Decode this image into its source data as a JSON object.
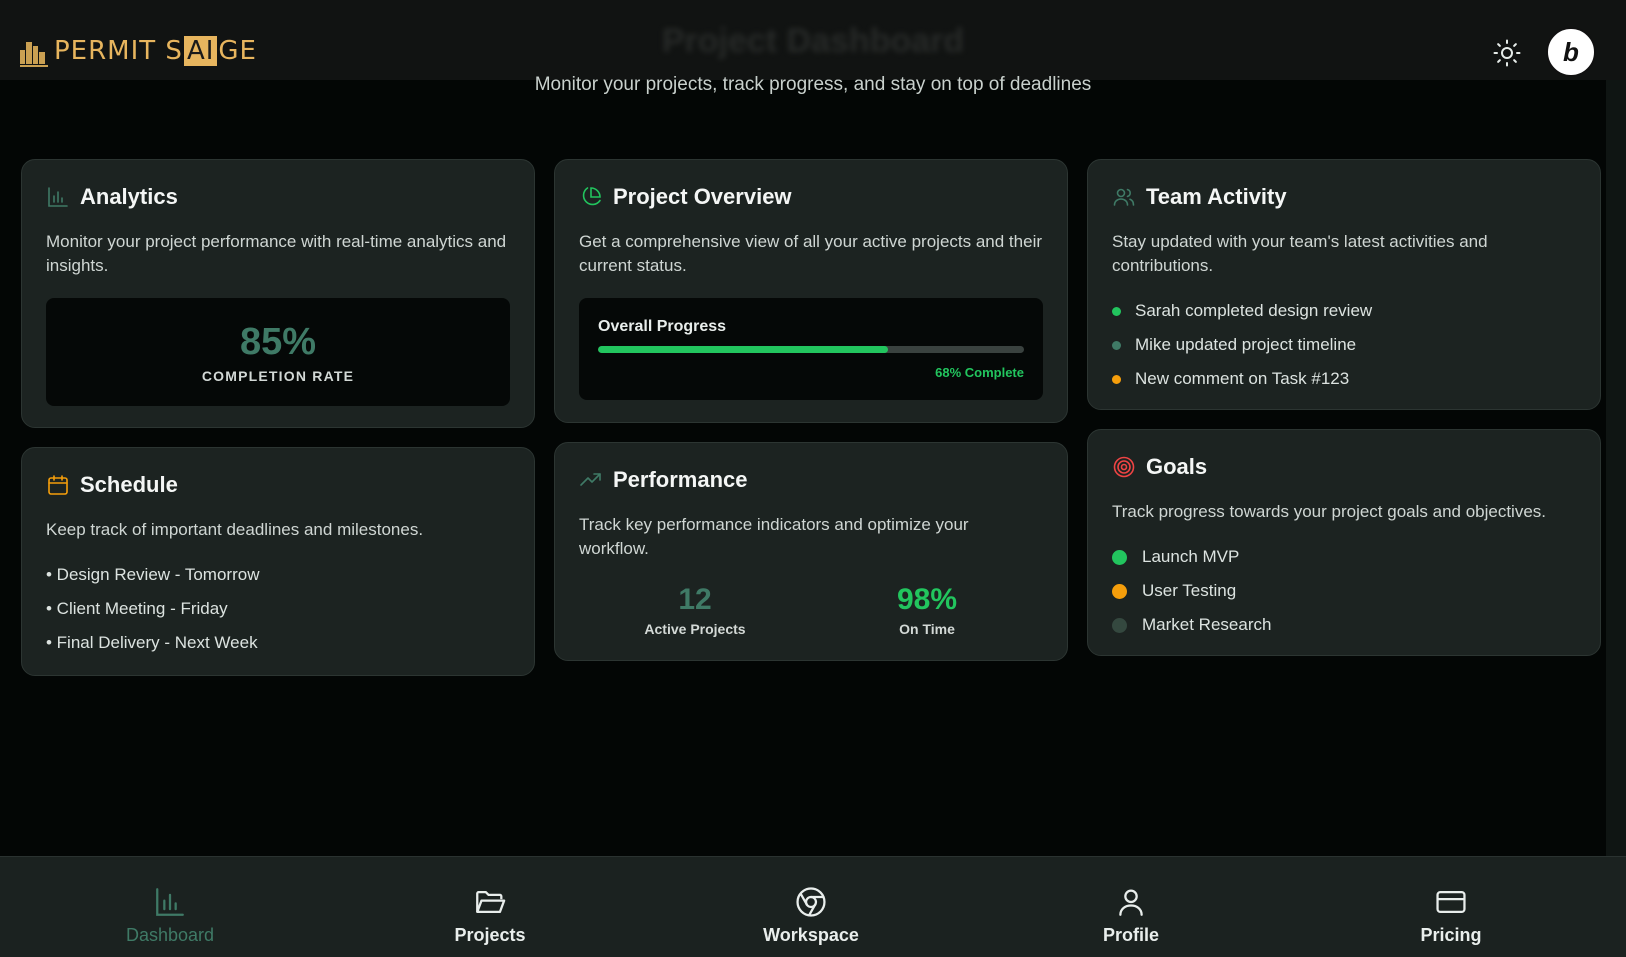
{
  "header": {
    "brand_prefix": "PERMIT S",
    "brand_ai": "AI",
    "brand_suffix": "GE",
    "page_title": "Project Dashboard",
    "subtitle": "Monitor your projects, track progress, and stay on top of deadlines",
    "badge_letter": "b"
  },
  "cards": {
    "analytics": {
      "title": "Analytics",
      "description": "Monitor your project performance with real-time analytics and insights.",
      "stat_value": "85%",
      "stat_label": "COMPLETION RATE"
    },
    "overview": {
      "title": "Project Overview",
      "description": "Get a comprehensive view of all your active projects and their current status.",
      "progress_label": "Overall Progress",
      "progress_value": 0.68,
      "progress_text": "68% Complete"
    },
    "team": {
      "title": "Team Activity",
      "description": "Stay updated with your team's latest activities and contributions.",
      "items": [
        {
          "text": "Sarah completed design review",
          "color": "#22c55e"
        },
        {
          "text": "Mike updated project timeline",
          "color": "#3f7a66"
        },
        {
          "text": "New comment on Task #123",
          "color": "#f59e0b"
        }
      ]
    },
    "schedule": {
      "title": "Schedule",
      "description": "Keep track of important deadlines and milestones.",
      "items": [
        "• Design Review - Tomorrow",
        "• Client Meeting - Friday",
        "• Final Delivery - Next Week"
      ]
    },
    "performance": {
      "title": "Performance",
      "description": "Track key performance indicators and optimize your workflow.",
      "stats": [
        {
          "value": "12",
          "label": "Active Projects",
          "color": "#3f7a66"
        },
        {
          "value": "98%",
          "label": "On Time",
          "color": "#22c55e"
        }
      ]
    },
    "goals": {
      "title": "Goals",
      "description": "Track progress towards your project goals and objectives.",
      "items": [
        {
          "text": "Launch MVP",
          "color": "#22c55e"
        },
        {
          "text": "User Testing",
          "color": "#f59e0b"
        },
        {
          "text": "Market Research",
          "color": "#34483f"
        }
      ]
    }
  },
  "nav": {
    "items": [
      {
        "label": "Dashboard",
        "icon": "bar-chart-icon",
        "active": true
      },
      {
        "label": "Projects",
        "icon": "folder-open-icon",
        "active": false
      },
      {
        "label": "Workspace",
        "icon": "chrome-icon",
        "active": false
      },
      {
        "label": "Profile",
        "icon": "user-icon",
        "active": false
      },
      {
        "label": "Pricing",
        "icon": "credit-card-icon",
        "active": false
      }
    ]
  },
  "colors": {
    "accent_green": "#22c55e",
    "muted_green": "#3f7a66",
    "amber": "#f59e0b",
    "brand_gold": "#e7b55e"
  }
}
